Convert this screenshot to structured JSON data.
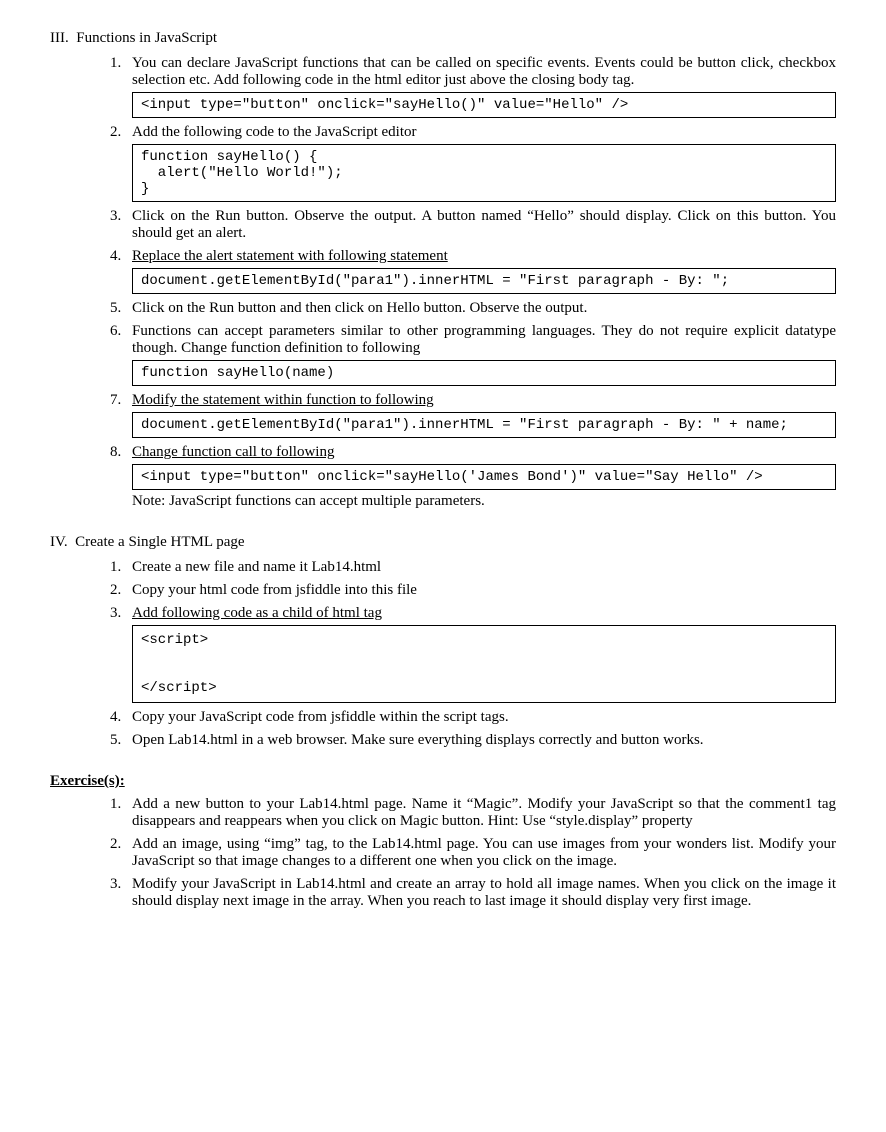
{
  "section3": {
    "title": "III.  Functions in JavaScript",
    "items": [
      {
        "num": "1.",
        "text": "You can declare JavaScript functions that can be called on specific events. Events could be button click, checkbox selection etc. Add following code in the html editor just above the closing body tag.",
        "code": "<input type=\"button\" onclick=\"sayHello()\" value=\"Hello\" />"
      },
      {
        "num": "2.",
        "text": "Add the following code to the JavaScript editor",
        "code": "function sayHello() {\n  alert(\"Hello World!\");\n}"
      },
      {
        "num": "3.",
        "text": "Click on the Run button. Observe the output. A button named “Hello” should display. Click on this button. You should get an alert."
      },
      {
        "num": "4.",
        "text_underline": "Replace the alert statement with following statement",
        "code": "document.getElementById(\"para1\").innerHTML = \"First paragraph - By: \";"
      },
      {
        "num": "5.",
        "text": "Click on the Run button and then click on Hello button. Observe the output."
      },
      {
        "num": "6.",
        "text": "Functions can accept parameters similar to other programming languages. They do not require explicit datatype though. Change function definition to following",
        "code": "function sayHello(name)"
      },
      {
        "num": "7.",
        "text_underline": "Modify the statement within function to following",
        "code": "document.getElementById(\"para1\").innerHTML = \"First paragraph - By: \" + name;"
      },
      {
        "num": "8.",
        "text_underline": "Change function call to following",
        "code": "<input type=\"button\" onclick=\"sayHello('James Bond')\" value=\"Say Hello\" />",
        "note": "Note: JavaScript functions can accept multiple parameters."
      }
    ]
  },
  "section4": {
    "title": "IV.  Create a Single HTML page",
    "items": [
      {
        "num": "1.",
        "text": "Create a new file and name it Lab14.html"
      },
      {
        "num": "2.",
        "text": "Copy your html code from jsfiddle into this file"
      },
      {
        "num": "3.",
        "text_underline": "Add following code as a child of html tag",
        "code_tall": "<script>\n\n\n</script>"
      },
      {
        "num": "4.",
        "text": "Copy your JavaScript code from jsfiddle within the script tags."
      },
      {
        "num": "5.",
        "text": "Open Lab14.html in a web browser. Make sure everything displays correctly and button works."
      }
    ]
  },
  "exercises": {
    "title": "Exercise(s):",
    "items": [
      {
        "num": "1.",
        "text": "Add a new button to your Lab14.html page. Name it “Magic”. Modify your JavaScript so that the comment1 tag disappears and reappears when you click on Magic button.\nHint: Use “style.display” property"
      },
      {
        "num": "2.",
        "text": "Add an image, using “img” tag, to the Lab14.html page. You can use images from your wonders list. Modify your JavaScript so that image changes to a different one when you click on the image."
      },
      {
        "num": "3.",
        "text": "Modify your JavaScript in Lab14.html and create an array to hold all image names. When you click on the image it should display next image in the array. When you reach to last image it should display very first image."
      }
    ]
  }
}
